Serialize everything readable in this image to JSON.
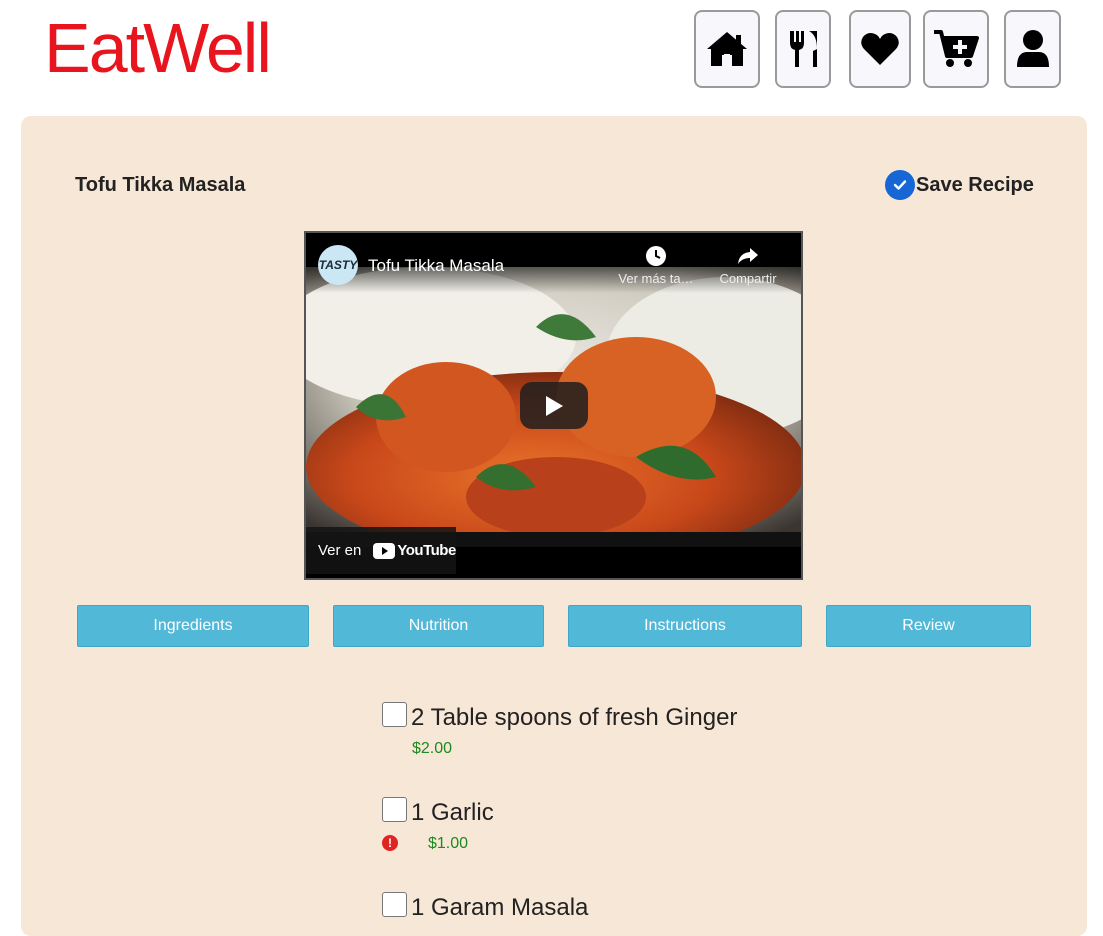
{
  "app": {
    "logo_text": "EatWell"
  },
  "nav": [
    {
      "name": "home",
      "icon": "home-icon"
    },
    {
      "name": "recipes",
      "icon": "fork-knife-icon"
    },
    {
      "name": "favorites",
      "icon": "heart-icon"
    },
    {
      "name": "cart",
      "icon": "cart-plus-icon"
    },
    {
      "name": "profile",
      "icon": "user-icon"
    }
  ],
  "recipe": {
    "title": "Tofu Tikka Masala",
    "save_label": "Save Recipe",
    "saved": true
  },
  "video": {
    "channel_badge": "TASTY",
    "title": "Tofu Tikka Masala",
    "watch_later_label": "Ver más ta…",
    "share_label": "Compartir",
    "watch_on_label": "Ver en",
    "platform_label": "YouTube"
  },
  "tabs": {
    "ingredients": "Ingredients",
    "nutrition": "Nutrition",
    "instructions": "Instructions",
    "review": "Review"
  },
  "ingredients": [
    {
      "name": "2 Table spoons of fresh Ginger",
      "price": "$2.00",
      "warning": false,
      "checked": false
    },
    {
      "name": "1 Garlic",
      "price": "$1.00",
      "warning": true,
      "checked": false
    },
    {
      "name": "1 Garam Masala",
      "price": "",
      "warning": false,
      "checked": false
    }
  ],
  "colors": {
    "brand": "#e8141e",
    "card_bg": "#f7e7d6",
    "tab_bg": "#51b8d8",
    "price": "#1c8a1c",
    "save_check": "#1666d6",
    "warning": "#e02424"
  }
}
